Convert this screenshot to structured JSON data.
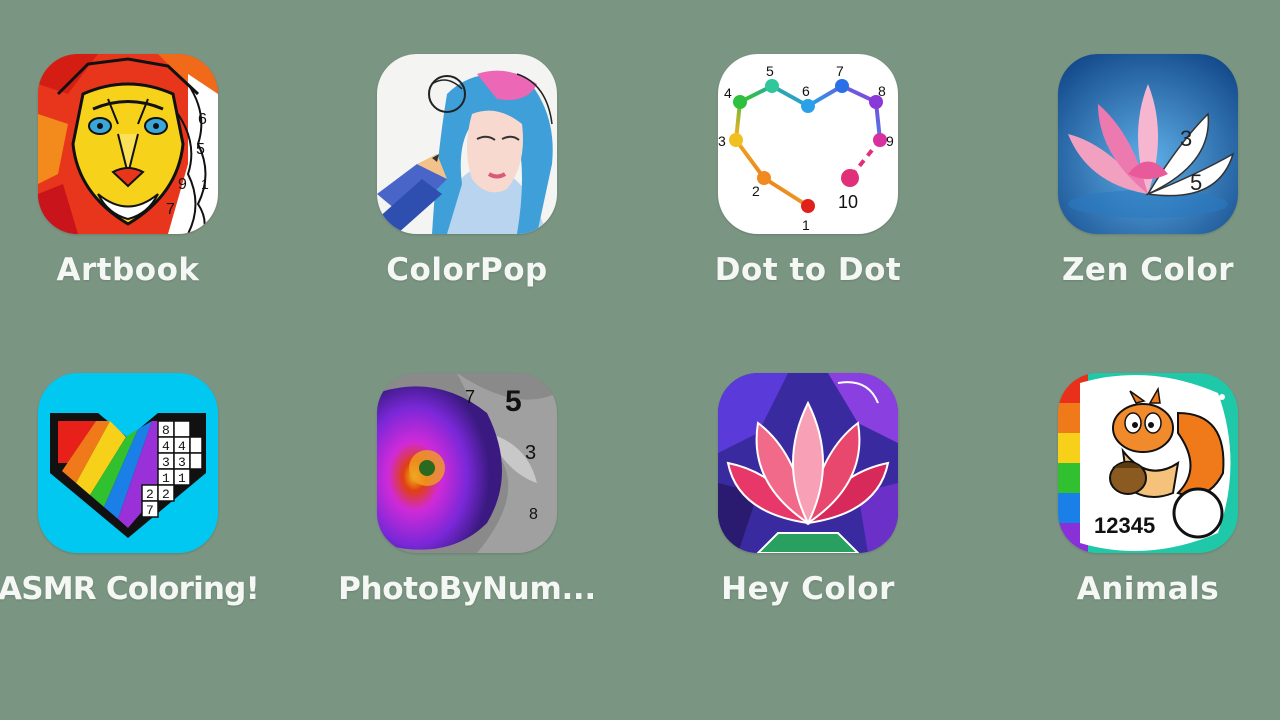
{
  "background_color": "#7a9582",
  "apps": [
    {
      "label": "Artbook",
      "icon": "lion-coloring-icon"
    },
    {
      "label": "ColorPop",
      "icon": "girl-sketch-pencil-icon"
    },
    {
      "label": "Dot to Dot",
      "icon": "dot-heart-icon",
      "dots": [
        "1",
        "2",
        "3",
        "4",
        "5",
        "6",
        "7",
        "8",
        "9",
        "10"
      ]
    },
    {
      "label": "Zen Color",
      "icon": "lotus-number-icon",
      "numbers": [
        "3",
        "5"
      ]
    },
    {
      "label": "ASMR Coloring!",
      "icon": "pixel-heart-icon",
      "numbers": [
        "8",
        "4",
        "4",
        "3",
        "3",
        "1",
        "1",
        "2",
        "2",
        "7"
      ]
    },
    {
      "label": "PhotoByNum...",
      "icon": "flower-photo-icon",
      "numbers": [
        "7",
        "5",
        "3",
        "8"
      ]
    },
    {
      "label": "Hey Color",
      "icon": "stained-lotus-icon"
    },
    {
      "label": "Animals",
      "icon": "squirrel-numbers-icon",
      "numbers": "12345"
    }
  ]
}
